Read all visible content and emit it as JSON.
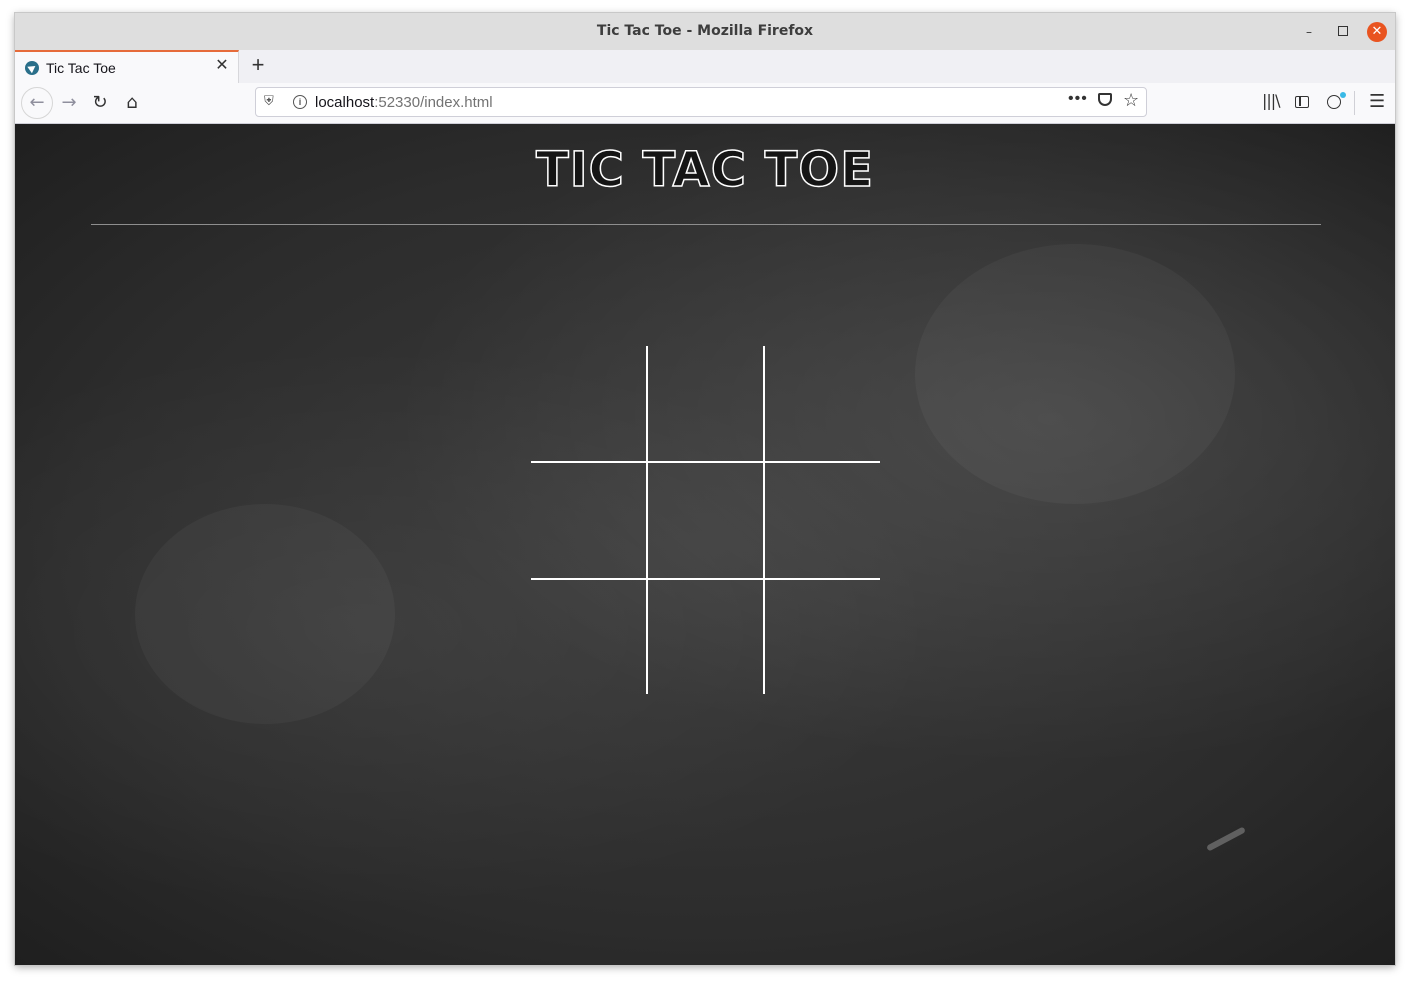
{
  "window": {
    "title": "Tic Tac Toe - Mozilla Firefox"
  },
  "tabs": [
    {
      "label": "Tic Tac Toe"
    }
  ],
  "navbar": {
    "url_host": "localhost",
    "url_rest": ":52330/index.html"
  },
  "page": {
    "title": "TIC TAC TOE",
    "board": {
      "cells": [
        "",
        "",
        "",
        "",
        "",
        "",
        "",
        "",
        ""
      ]
    }
  }
}
